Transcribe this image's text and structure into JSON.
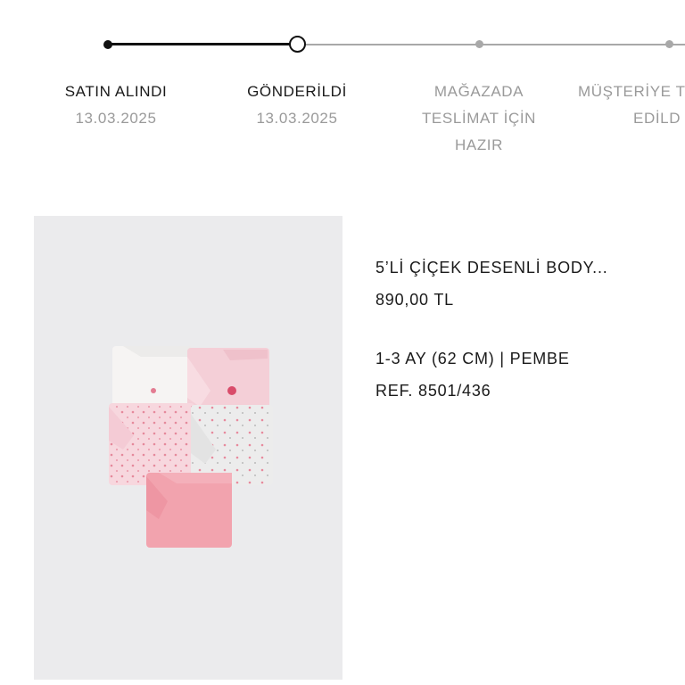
{
  "tracker": {
    "steps": [
      {
        "label": "SATIN ALINDI",
        "date": "13.03.2025",
        "state": "done"
      },
      {
        "label": "GÖNDERİLDİ",
        "date": "13.03.2025",
        "state": "current"
      },
      {
        "label_lines": [
          "MAĞAZADA",
          "TESLİMAT İÇİN",
          "HAZIR"
        ],
        "state": "pending"
      },
      {
        "label_lines": [
          "MÜŞTERİYE T",
          "EDİLD"
        ],
        "state": "pending"
      }
    ],
    "colors": {
      "done": "#111111",
      "pending": "#a8a8a8"
    }
  },
  "product": {
    "image_alt": "5 baby bodysuits in pink, white and grey with floral prints",
    "name": "5’Lİ ÇİÇEK DESENLİ BODY...",
    "price": "890,00 TL",
    "variant": "1-3 AY (62 CM) | PEMBE",
    "reference": "REF. 8501/436"
  }
}
